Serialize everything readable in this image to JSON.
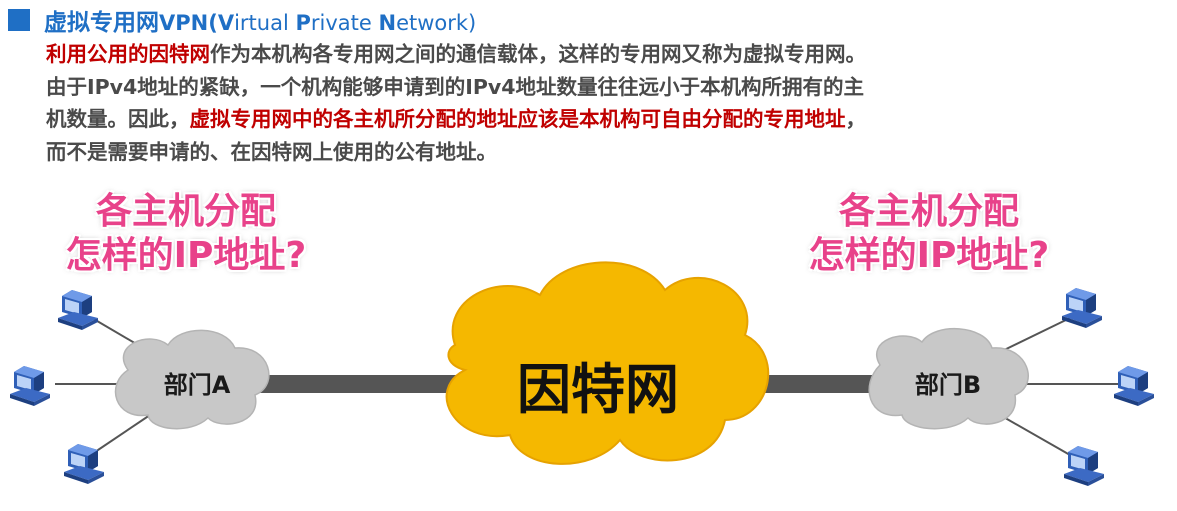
{
  "header": {
    "title_cn": "虚拟专用网",
    "title_vpn": "VPN(",
    "title_v": "V",
    "title_irtual": "irtual ",
    "title_p": "P",
    "title_rivate": "rivate ",
    "title_n": "N",
    "title_etwork": "etwork)"
  },
  "body": {
    "line1_highlight": "利用公用的因特网",
    "line1_rest": "作为本机构各专用网之间的通信载体，这样的专用网又称为虚拟专用网。",
    "line2": "由于IPv4地址的紧缺，一个机构能够申请到的IPv4地址数量往往远小于本机构所拥有的主",
    "line3_pre": "机数量。因此，",
    "line3_highlight": "虚拟专用网中的各主机所分配的地址应该是本机构可自由分配的专用地址",
    "line3_post": "，",
    "line4": "而不是需要申请的、在因特网上使用的公有地址。"
  },
  "diagram": {
    "question_left_line1": "各主机分配",
    "question_left_line2": "怎样的IP地址?",
    "question_right_line1": "各主机分配",
    "question_right_line2": "怎样的IP地址?",
    "dept_a_label": "部门A",
    "dept_b_label": "部门B",
    "internet_label": "因特网",
    "colors": {
      "title_blue": "#1f6fc5",
      "highlight_red": "#c00000",
      "question_pink": "#e8428a",
      "internet_cloud": "#f5b800",
      "dept_cloud": "#c8c8c8",
      "link_gray": "#555555"
    }
  }
}
